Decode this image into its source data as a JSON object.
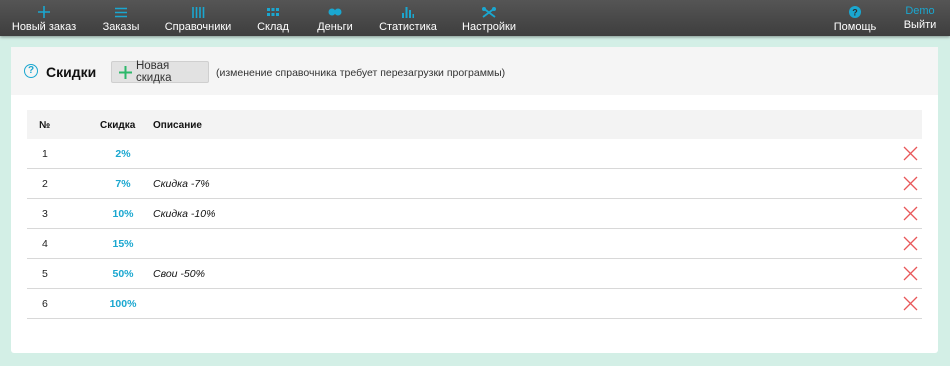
{
  "nav": {
    "items": [
      {
        "label": "Новый заказ",
        "icon": "plus-icon"
      },
      {
        "label": "Заказы",
        "icon": "menu-icon"
      },
      {
        "label": "Справочники",
        "icon": "books-icon"
      },
      {
        "label": "Склад",
        "icon": "grid-icon"
      },
      {
        "label": "Деньги",
        "icon": "coins-icon"
      },
      {
        "label": "Статистика",
        "icon": "bar-chart-icon"
      },
      {
        "label": "Настройки",
        "icon": "tools-icon"
      }
    ],
    "help_label": "Помощь",
    "user_name": "Demo",
    "logout_label": "Выйти"
  },
  "colors": {
    "accent": "#1aa7d0",
    "plus": "#2cb86a",
    "delete": "#e8585a",
    "topbar": "#464646",
    "page_bg": "#d3efe6"
  },
  "panel": {
    "title": "Скидки",
    "new_button_label": "Новая скидка",
    "note": "(изменение справочника требует перезагрузки программы)"
  },
  "table": {
    "headers": {
      "num": "№",
      "discount": "Скидка",
      "description": "Описание"
    },
    "rows": [
      {
        "num": "1",
        "discount": "2%",
        "description": ""
      },
      {
        "num": "2",
        "discount": "7%",
        "description": "Скидка -7%"
      },
      {
        "num": "3",
        "discount": "10%",
        "description": "Скидка -10%"
      },
      {
        "num": "4",
        "discount": "15%",
        "description": ""
      },
      {
        "num": "5",
        "discount": "50%",
        "description": "Свои -50%"
      },
      {
        "num": "6",
        "discount": "100%",
        "description": ""
      }
    ]
  }
}
